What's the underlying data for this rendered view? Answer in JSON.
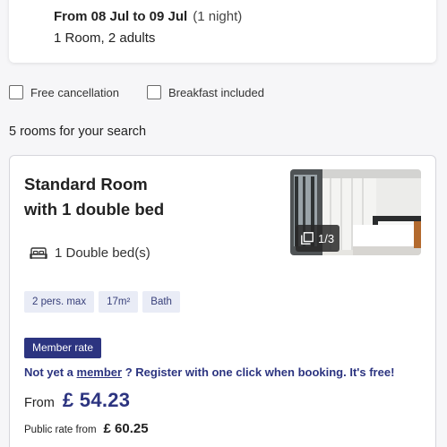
{
  "search": {
    "dates_label": "From 08 Jul to 09 Jul",
    "nights": "(1 night)",
    "guests": "1 Room, 2 adults"
  },
  "filters": [
    {
      "label": "Free cancellation",
      "checked": false
    },
    {
      "label": "Breakfast included",
      "checked": false
    }
  ],
  "results": {
    "count_text": "5 rooms for your search"
  },
  "room": {
    "title_line1": "Standard Room",
    "title_line2": "with 1 double bed",
    "photo_counter": "1/3",
    "bed": "1 Double bed(s)",
    "bed_icon": "bed-icon",
    "tags": [
      "2 pers. max",
      "17m²",
      "Bath"
    ],
    "member_badge": "Member rate",
    "promo_prefix": "Not yet a ",
    "promo_link": "member",
    "promo_suffix": " ? Register with one click when booking. It's free!",
    "price_from_label": "From",
    "price": "£ 54.23",
    "public_rate_label": "Public rate from",
    "public_rate": "£ 60.25"
  },
  "colors": {
    "brand": "#2c3480",
    "tag_bg": "#e9ecf6",
    "card_border": "#d6d6dc",
    "page_bg": "#f6f6f8"
  }
}
